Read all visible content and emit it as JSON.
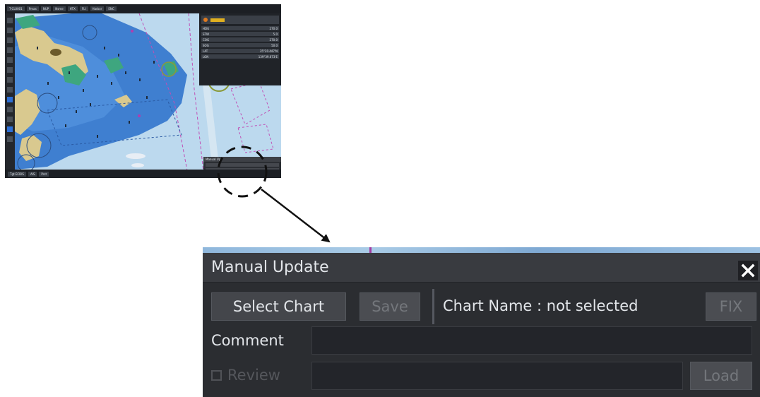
{
  "thumbnail": {
    "topbar_chips": [
      "T-CL0001",
      "Pmax",
      "NUP",
      "Nsme",
      "HTX",
      "FLI",
      "Harbor",
      "ENC"
    ],
    "botbar_chips": [
      "Tgt ECDIS",
      "AIS",
      "Prst"
    ],
    "right_panel_rows": [
      {
        "label": "HDG",
        "value": "270.0"
      },
      {
        "label": "STW",
        "value": "5.0"
      },
      {
        "label": "COG",
        "value": "270.0"
      },
      {
        "label": "SOG",
        "value": "50.0"
      },
      {
        "label": "LAT",
        "value": "35°20.447'N"
      },
      {
        "label": "LON",
        "value": "139°39.673'E"
      }
    ],
    "mini_dialog_title": "Manual Up"
  },
  "dialog": {
    "title": "Manual Update",
    "close_label": "✕",
    "select_chart_label": "Select Chart",
    "save_label": "Save",
    "chart_name_label": "Chart Name : not selected",
    "fix_label": "FIX",
    "comment_label": "Comment",
    "comment_value": "",
    "review_label": "Review",
    "review_value": "",
    "load_label": "Load"
  },
  "colors": {
    "deep_water": "#3f7fd0",
    "shallow_water": "#7fb4e3",
    "land": "#d9c98f",
    "green_area": "#3ea67f",
    "dialog_bg": "#2b2d31",
    "disabled_text": "#74777c"
  }
}
